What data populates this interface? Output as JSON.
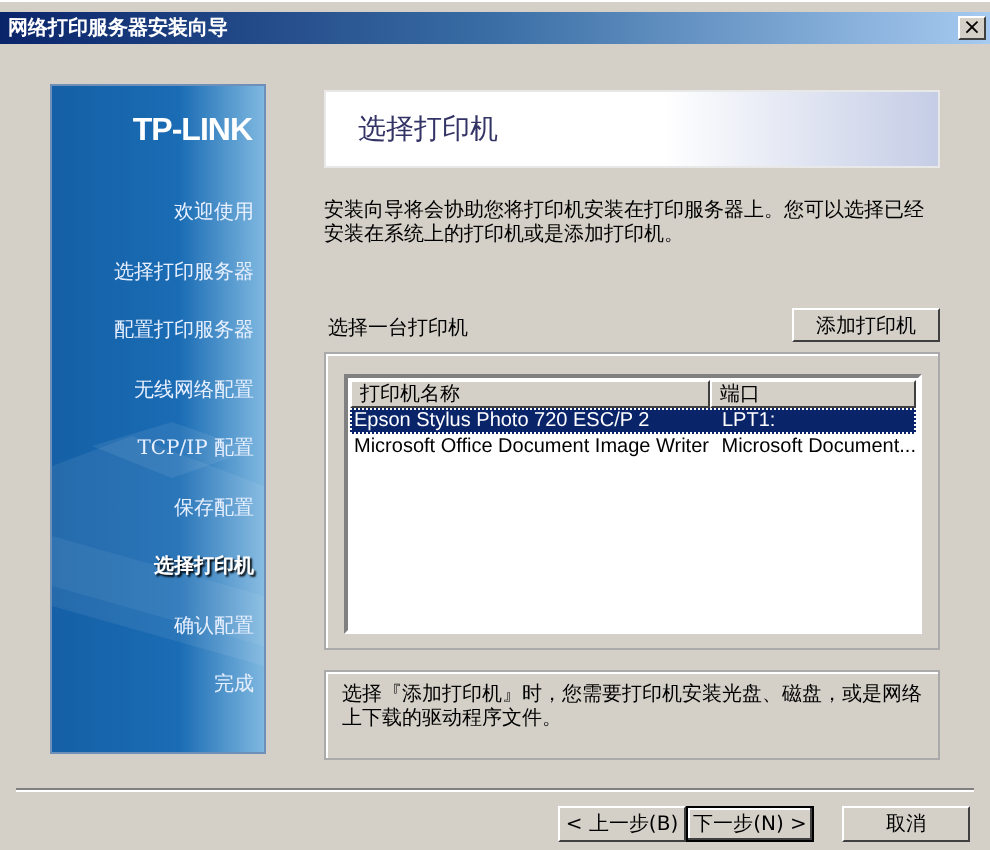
{
  "window": {
    "title": "网络打印服务器安装向导",
    "close_glyph": "×"
  },
  "sidebar": {
    "logo": "TP-LINK",
    "items": [
      {
        "label": "欢迎使用",
        "selected": false
      },
      {
        "label": "选择打印服务器",
        "selected": false
      },
      {
        "label": "配置打印服务器",
        "selected": false
      },
      {
        "label": "无线网络配置",
        "selected": false
      },
      {
        "label": "TCP/IP 配置",
        "selected": false
      },
      {
        "label": "保存配置",
        "selected": false
      },
      {
        "label": "选择打印机",
        "selected": true
      },
      {
        "label": "确认配置",
        "selected": false
      },
      {
        "label": "完成",
        "selected": false
      }
    ]
  },
  "header": {
    "title": "选择打印机"
  },
  "description": "安装向导将会协助您将打印机安装在打印服务器上。您可以选择已经安装在系统上的打印机或是添加打印机。",
  "printer_section": {
    "label": "选择一台打印机",
    "add_button": "添加打印机"
  },
  "table": {
    "columns": [
      "打印机名称",
      "端口"
    ],
    "rows": [
      {
        "cells": [
          "Epson Stylus Photo 720 ESC/P 2",
          "LPT1:"
        ],
        "selected": true
      },
      {
        "cells": [
          "Microsoft Office Document Image Writer",
          "Microsoft Document..."
        ],
        "selected": false
      }
    ]
  },
  "hint": "选择『添加打印机』时，您需要打印机安装光盘、磁盘，或是网络上下载的驱动程序文件。",
  "buttons": [
    {
      "label": "< 上一步(B)",
      "default": false
    },
    {
      "label": "下一步(N) >",
      "default": true
    },
    {
      "label": "取消",
      "default": false
    }
  ]
}
